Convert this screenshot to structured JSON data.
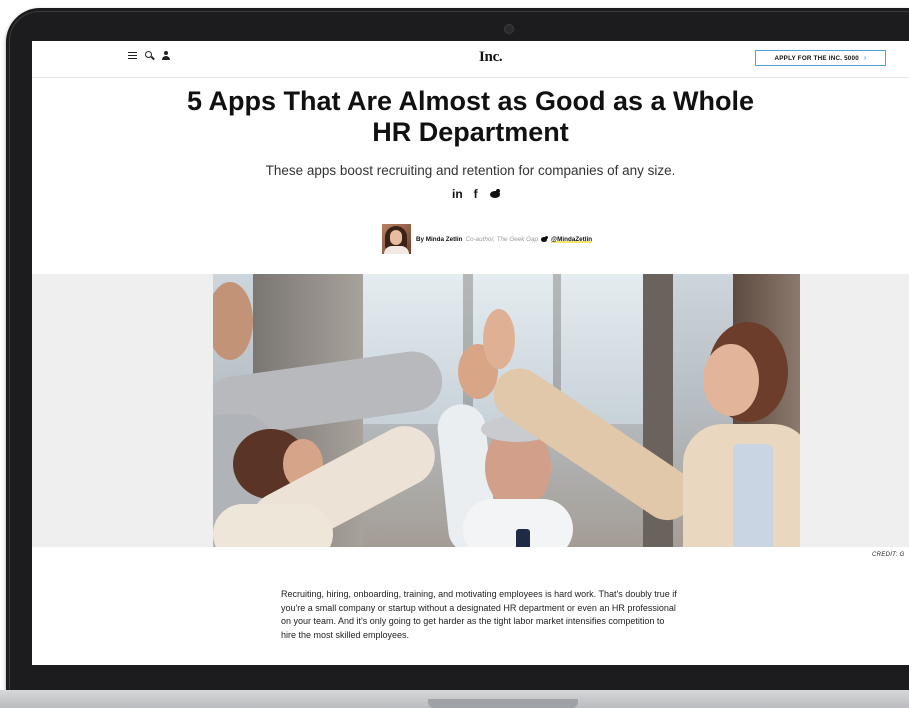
{
  "header": {
    "logo": "Inc.",
    "apply_button": "APPLY FOR THE INC. 5000",
    "apply_arrow": "›",
    "nav_icons": [
      "menu-icon",
      "search-icon",
      "user-icon"
    ]
  },
  "article": {
    "headline": "5 Apps That Are Almost as Good as a Whole HR Department",
    "dek": "These apps boost recruiting and retention for companies of any size.",
    "share": {
      "linkedin": "in",
      "facebook": "f",
      "icons": [
        "linkedin-icon",
        "facebook-icon",
        "twitter-icon"
      ]
    },
    "byline": {
      "author": "By Minda Zetlin",
      "role": "Co-author, The Geek Gap",
      "handle": "@MindaZetlin"
    },
    "image_credit": "CREDIT: G",
    "body": "Recruiting, hiring, onboarding, training, and motivating employees is hard work. That's doubly true if you're a small company or startup without a designated HR department or even an HR professional on your team. And it's only going to get harder as the tight labor market intensifies competition to hire the most skilled employees."
  },
  "colors": {
    "accent_border": "#4aa3d9",
    "handle_highlight": "#f2e56a"
  }
}
